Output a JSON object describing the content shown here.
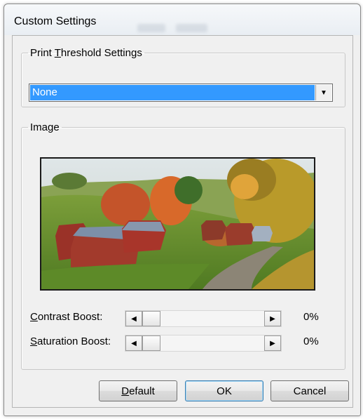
{
  "window": {
    "title": "Custom Settings"
  },
  "threshold": {
    "group_label_pre": "Print ",
    "group_label_u": "T",
    "group_label_post": "hreshold Settings",
    "selected": "None"
  },
  "image_group": {
    "label": "Image"
  },
  "sliders": [
    {
      "label_u": "C",
      "label_rest": "ontrast Boost:",
      "value": "0%"
    },
    {
      "label_u": "S",
      "label_rest": "aturation Boost:",
      "value": "0%"
    }
  ],
  "buttons": {
    "default_u": "D",
    "default_rest": "efault",
    "ok": "OK",
    "cancel": "Cancel"
  }
}
